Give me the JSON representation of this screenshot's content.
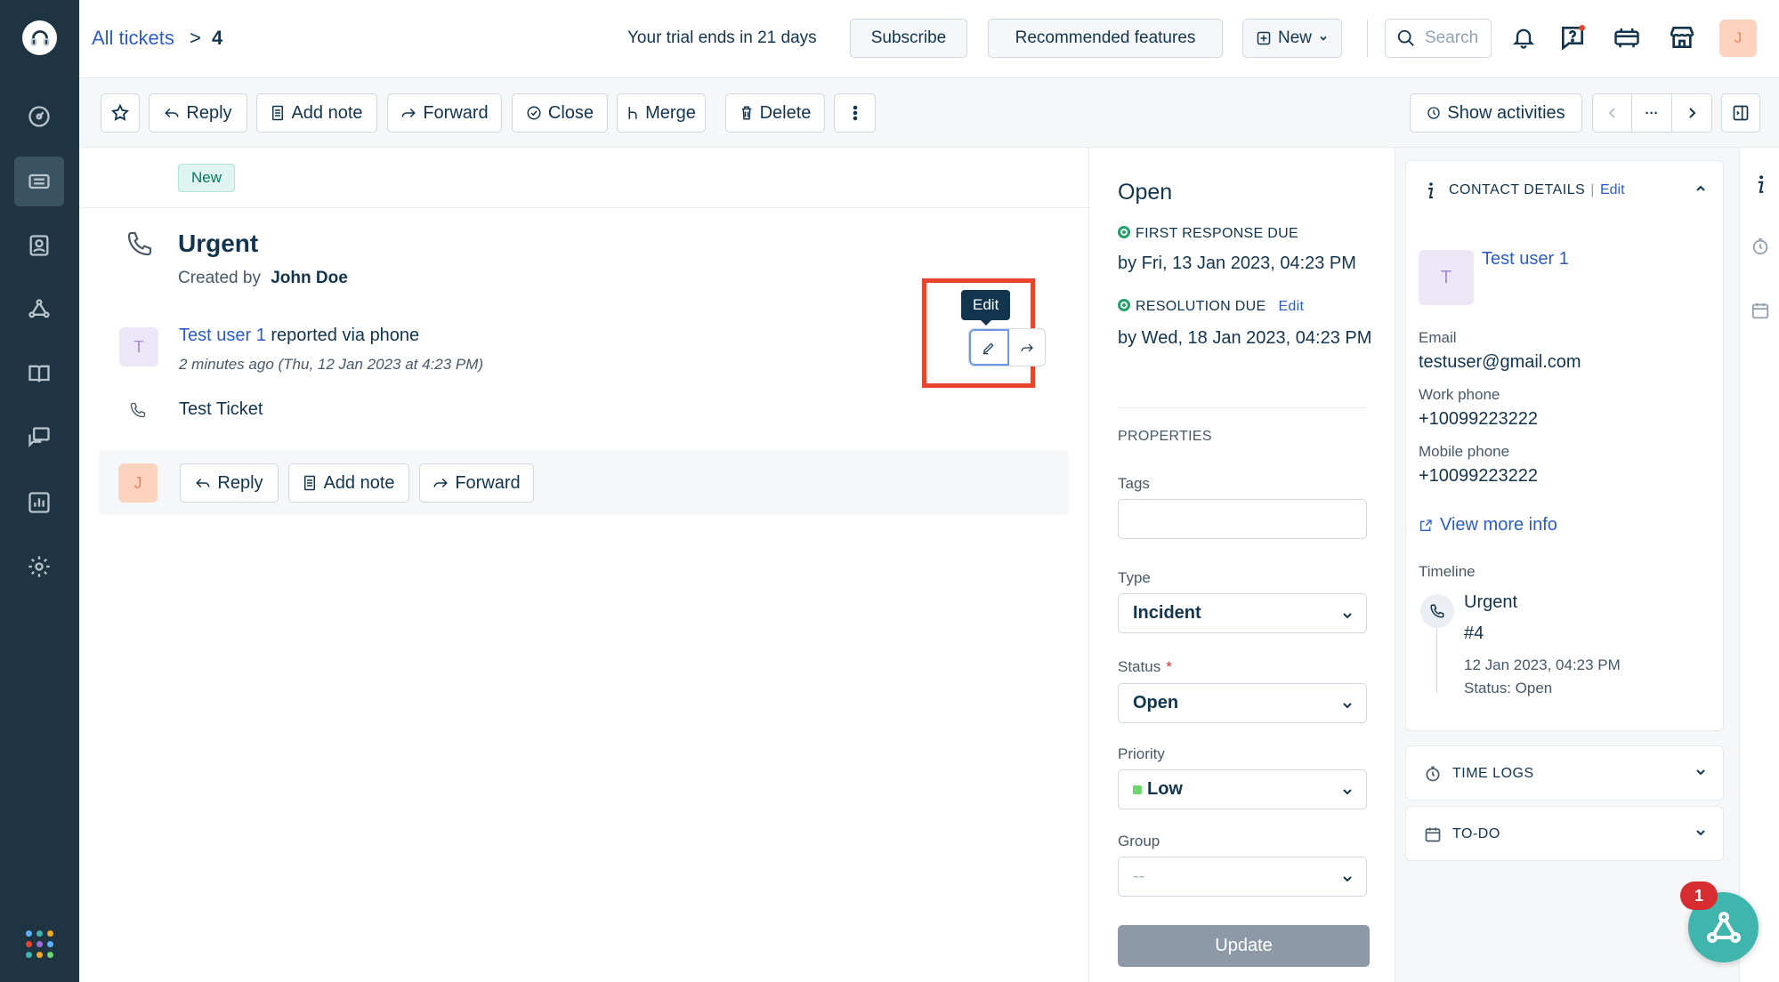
{
  "breadcrumb": {
    "parent": "All tickets",
    "separator": ">",
    "current": "4"
  },
  "topbar": {
    "trial_text": "Your trial ends in 21 days",
    "subscribe_label": "Subscribe",
    "recommended_label": "Recommended features",
    "new_label": "New",
    "search_placeholder": "Search",
    "avatar_initial": "J",
    "icons": [
      "bell-icon",
      "help-icon",
      "announcements-icon",
      "marketplace-icon"
    ]
  },
  "toolbar": {
    "reply": "Reply",
    "add_note": "Add note",
    "forward": "Forward",
    "close": "Close",
    "merge": "Merge",
    "delete": "Delete",
    "show_activities": "Show activities",
    "nav_more": "···"
  },
  "ticket": {
    "badge": "New",
    "title": "Urgent",
    "created_by_label": "Created by",
    "created_by": "John Doe",
    "requester_initial": "T",
    "requester_name": "Test user 1",
    "reported_via": "reported via phone",
    "time": "2 minutes ago (Thu, 12 Jan 2023 at 4:23 PM)",
    "description": "Test Ticket",
    "tooltip": "Edit",
    "reply_bar": {
      "avatar_initial": "J",
      "reply": "Reply",
      "add_note": "Add note",
      "forward": "Forward"
    }
  },
  "properties": {
    "status_heading": "Open",
    "first_response_label": "FIRST RESPONSE DUE",
    "first_response_value": "by Fri, 13 Jan 2023, 04:23 PM",
    "resolution_label": "RESOLUTION DUE",
    "resolution_edit": "Edit",
    "resolution_value": "by Wed, 18 Jan 2023, 04:23 PM",
    "section_title": "PROPERTIES",
    "tags_label": "Tags",
    "tags_value": "",
    "type_label": "Type",
    "type_value": "Incident",
    "status_label": "Status",
    "status_required": "*",
    "status_value": "Open",
    "priority_label": "Priority",
    "priority_value": "Low",
    "priority_color": "#6ad66b",
    "group_label": "Group",
    "group_value": "--",
    "update_label": "Update"
  },
  "contact": {
    "heading": "CONTACT DETAILS",
    "pipe": "|",
    "edit": "Edit",
    "avatar_initial": "T",
    "name": "Test user 1",
    "email_label": "Email",
    "email": "testuser@gmail.com",
    "work_phone_label": "Work phone",
    "work_phone": "+10099223222",
    "mobile_phone_label": "Mobile phone",
    "mobile_phone": "+10099223222",
    "view_more": "View more info",
    "timeline_label": "Timeline",
    "timeline_title": "Urgent",
    "timeline_id": "#4",
    "timeline_time": "12 Jan 2023, 04:23 PM",
    "timeline_status": "Status: Open"
  },
  "time_logs": {
    "heading": "TIME LOGS"
  },
  "todo": {
    "heading": "TO-DO"
  },
  "fab": {
    "badge": "1"
  },
  "colors": {
    "accent": "#2c5cc5",
    "nav_bg": "#1f3442",
    "highlight": "#e8452c",
    "widget": "#3fb5ad"
  }
}
